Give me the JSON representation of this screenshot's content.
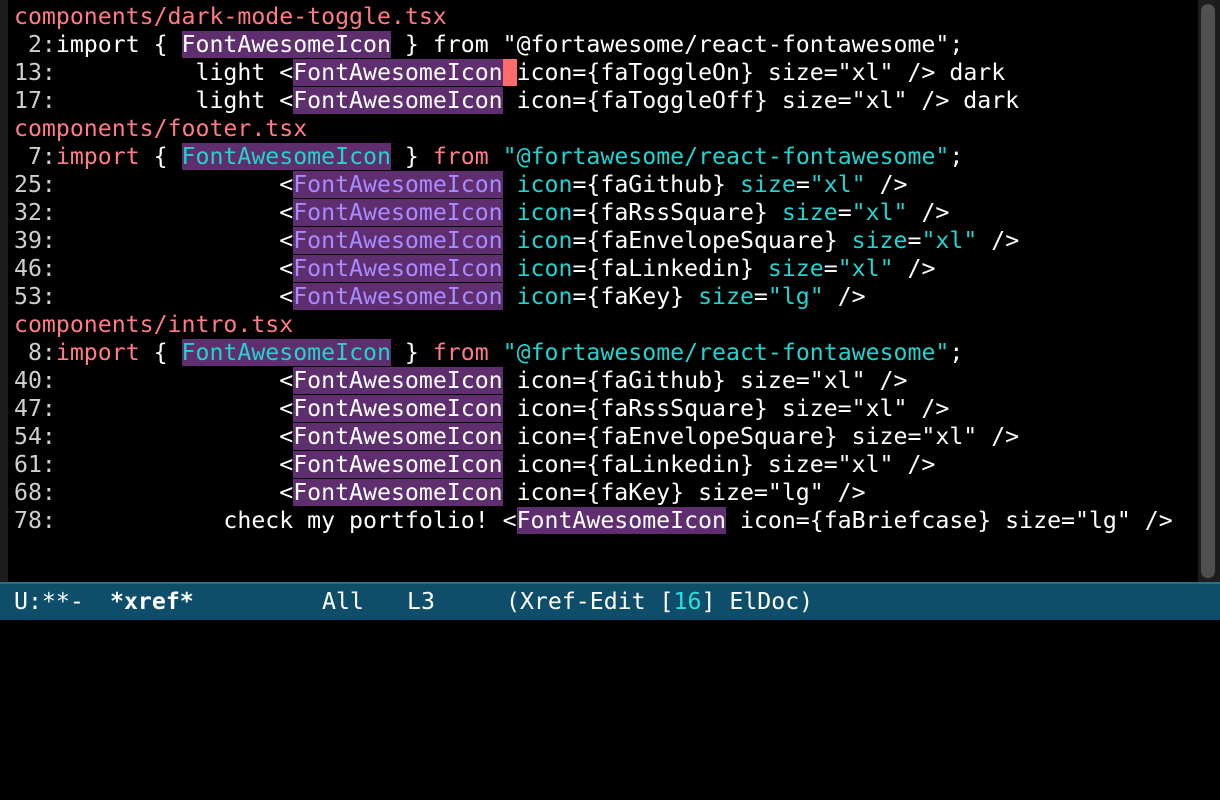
{
  "colors": {
    "file_header": "#ff7b85",
    "string_cyan": "#22d3d0",
    "symbol_purple": "#a98bff",
    "highlight_bg": "#5e2e6e",
    "cursor": "#ff6b6b",
    "modeline_bg": "#0e4e6a",
    "background": "#000000"
  },
  "buffer": {
    "lines": [
      {
        "kind": "file",
        "segments": [
          {
            "t": "components/dark-mode-toggle.tsx",
            "c": "file"
          }
        ]
      },
      {
        "kind": "match",
        "segments": [
          {
            "t": " 2:",
            "c": "lno"
          },
          {
            "t": "import { ",
            "c": ""
          },
          {
            "t": "FontAwesomeIcon",
            "c": "hl-purple"
          },
          {
            "t": " } from \"@fortawesome/react-fontawesome\";",
            "c": ""
          }
        ]
      },
      {
        "kind": "match",
        "segments": [
          {
            "t": "13:",
            "c": "lno"
          },
          {
            "t": "          light <",
            "c": ""
          },
          {
            "t": "FontAwesomeIcon",
            "c": "hl-purple"
          },
          {
            "t": " ",
            "c": "cursor"
          },
          {
            "t": "icon={faToggleOn} size=\"xl\" /> dark",
            "c": ""
          }
        ]
      },
      {
        "kind": "match",
        "segments": [
          {
            "t": "17:",
            "c": "lno"
          },
          {
            "t": "          light <",
            "c": ""
          },
          {
            "t": "FontAwesomeIcon",
            "c": "hl-purple"
          },
          {
            "t": " icon={faToggleOff} size=\"xl\" /> dark",
            "c": ""
          }
        ]
      },
      {
        "kind": "file",
        "segments": [
          {
            "t": "components/footer.tsx",
            "c": "file"
          }
        ]
      },
      {
        "kind": "match",
        "segments": [
          {
            "t": " 7:",
            "c": "lno"
          },
          {
            "t": "import",
            "c": "kw-red"
          },
          {
            "t": " { ",
            "c": ""
          },
          {
            "t": "FontAwesomeIcon",
            "c": "hl-purple cyan"
          },
          {
            "t": " } ",
            "c": ""
          },
          {
            "t": "from",
            "c": "kw-red"
          },
          {
            "t": " ",
            "c": ""
          },
          {
            "t": "\"@fortawesome/react-fontawesome\"",
            "c": "str-cyan"
          },
          {
            "t": ";",
            "c": ""
          }
        ]
      },
      {
        "kind": "match",
        "segments": [
          {
            "t": "25:",
            "c": "lno"
          },
          {
            "t": "                <",
            "c": ""
          },
          {
            "t": "FontAwesomeIcon",
            "c": "hl-purple sym"
          },
          {
            "t": " ",
            "c": ""
          },
          {
            "t": "icon",
            "c": "str-cyan"
          },
          {
            "t": "={faGithub} ",
            "c": ""
          },
          {
            "t": "size",
            "c": "str-cyan"
          },
          {
            "t": "=",
            "c": ""
          },
          {
            "t": "\"xl\"",
            "c": "str-cyan"
          },
          {
            "t": " />",
            "c": ""
          }
        ]
      },
      {
        "kind": "match",
        "segments": [
          {
            "t": "32:",
            "c": "lno"
          },
          {
            "t": "                <",
            "c": ""
          },
          {
            "t": "FontAwesomeIcon",
            "c": "hl-purple sym"
          },
          {
            "t": " ",
            "c": ""
          },
          {
            "t": "icon",
            "c": "str-cyan"
          },
          {
            "t": "={faRssSquare} ",
            "c": ""
          },
          {
            "t": "size",
            "c": "str-cyan"
          },
          {
            "t": "=",
            "c": ""
          },
          {
            "t": "\"xl\"",
            "c": "str-cyan"
          },
          {
            "t": " />",
            "c": ""
          }
        ]
      },
      {
        "kind": "match",
        "segments": [
          {
            "t": "39:",
            "c": "lno"
          },
          {
            "t": "                <",
            "c": ""
          },
          {
            "t": "FontAwesomeIcon",
            "c": "hl-purple sym"
          },
          {
            "t": " ",
            "c": ""
          },
          {
            "t": "icon",
            "c": "str-cyan"
          },
          {
            "t": "={faEnvelopeSquare} ",
            "c": ""
          },
          {
            "t": "size",
            "c": "str-cyan"
          },
          {
            "t": "=",
            "c": ""
          },
          {
            "t": "\"xl\"",
            "c": "str-cyan"
          },
          {
            "t": " />",
            "c": ""
          }
        ]
      },
      {
        "kind": "match",
        "segments": [
          {
            "t": "46:",
            "c": "lno"
          },
          {
            "t": "                <",
            "c": ""
          },
          {
            "t": "FontAwesomeIcon",
            "c": "hl-purple sym"
          },
          {
            "t": " ",
            "c": ""
          },
          {
            "t": "icon",
            "c": "str-cyan"
          },
          {
            "t": "={faLinkedin} ",
            "c": ""
          },
          {
            "t": "size",
            "c": "str-cyan"
          },
          {
            "t": "=",
            "c": ""
          },
          {
            "t": "\"xl\"",
            "c": "str-cyan"
          },
          {
            "t": " />",
            "c": ""
          }
        ]
      },
      {
        "kind": "match",
        "segments": [
          {
            "t": "53:",
            "c": "lno"
          },
          {
            "t": "                <",
            "c": ""
          },
          {
            "t": "FontAwesomeIcon",
            "c": "hl-purple sym"
          },
          {
            "t": " ",
            "c": ""
          },
          {
            "t": "icon",
            "c": "str-cyan"
          },
          {
            "t": "={faKey} ",
            "c": ""
          },
          {
            "t": "size",
            "c": "str-cyan"
          },
          {
            "t": "=",
            "c": ""
          },
          {
            "t": "\"lg\"",
            "c": "str-cyan"
          },
          {
            "t": " />",
            "c": ""
          }
        ]
      },
      {
        "kind": "file",
        "segments": [
          {
            "t": "components/intro.tsx",
            "c": "file"
          }
        ]
      },
      {
        "kind": "match",
        "segments": [
          {
            "t": " 8:",
            "c": "lno"
          },
          {
            "t": "import",
            "c": "kw-red"
          },
          {
            "t": " { ",
            "c": ""
          },
          {
            "t": "FontAwesomeIcon",
            "c": "hl-purple cyan"
          },
          {
            "t": " } ",
            "c": ""
          },
          {
            "t": "from",
            "c": "kw-red"
          },
          {
            "t": " ",
            "c": ""
          },
          {
            "t": "\"@fortawesome/react-fontawesome\"",
            "c": "str-cyan"
          },
          {
            "t": ";",
            "c": ""
          }
        ]
      },
      {
        "kind": "match",
        "segments": [
          {
            "t": "40:",
            "c": "lno"
          },
          {
            "t": "                <",
            "c": ""
          },
          {
            "t": "FontAwesomeIcon",
            "c": "hl-purple"
          },
          {
            "t": " icon={faGithub} size=\"xl\" />",
            "c": ""
          }
        ]
      },
      {
        "kind": "match",
        "segments": [
          {
            "t": "47:",
            "c": "lno"
          },
          {
            "t": "                <",
            "c": ""
          },
          {
            "t": "FontAwesomeIcon",
            "c": "hl-purple"
          },
          {
            "t": " icon={faRssSquare} size=\"xl\" />",
            "c": ""
          }
        ]
      },
      {
        "kind": "match",
        "segments": [
          {
            "t": "54:",
            "c": "lno"
          },
          {
            "t": "                <",
            "c": ""
          },
          {
            "t": "FontAwesomeIcon",
            "c": "hl-purple"
          },
          {
            "t": " icon={faEnvelopeSquare} size=\"xl\" />",
            "c": ""
          }
        ]
      },
      {
        "kind": "match",
        "segments": [
          {
            "t": "61:",
            "c": "lno"
          },
          {
            "t": "                <",
            "c": ""
          },
          {
            "t": "FontAwesomeIcon",
            "c": "hl-purple"
          },
          {
            "t": " icon={faLinkedin} size=\"xl\" />",
            "c": ""
          }
        ]
      },
      {
        "kind": "match",
        "segments": [
          {
            "t": "68:",
            "c": "lno"
          },
          {
            "t": "                <",
            "c": ""
          },
          {
            "t": "FontAwesomeIcon",
            "c": "hl-purple"
          },
          {
            "t": " icon={faKey} size=\"lg\" />",
            "c": ""
          }
        ]
      },
      {
        "kind": "match",
        "segments": [
          {
            "t": "78:",
            "c": "lno"
          },
          {
            "t": "            check my portfolio! <",
            "c": ""
          },
          {
            "t": "FontAwesomeIcon",
            "c": "hl-purple"
          },
          {
            "t": " icon={faBriefcase} size=\"lg\" />",
            "c": ""
          }
        ]
      }
    ]
  },
  "modeline": {
    "status": "U:**-",
    "buffer_name": "*xref*",
    "position": "All",
    "line": "L3",
    "mode_open": "(Xref-Edit [",
    "count": "16",
    "mode_close": "] ElDoc)"
  }
}
